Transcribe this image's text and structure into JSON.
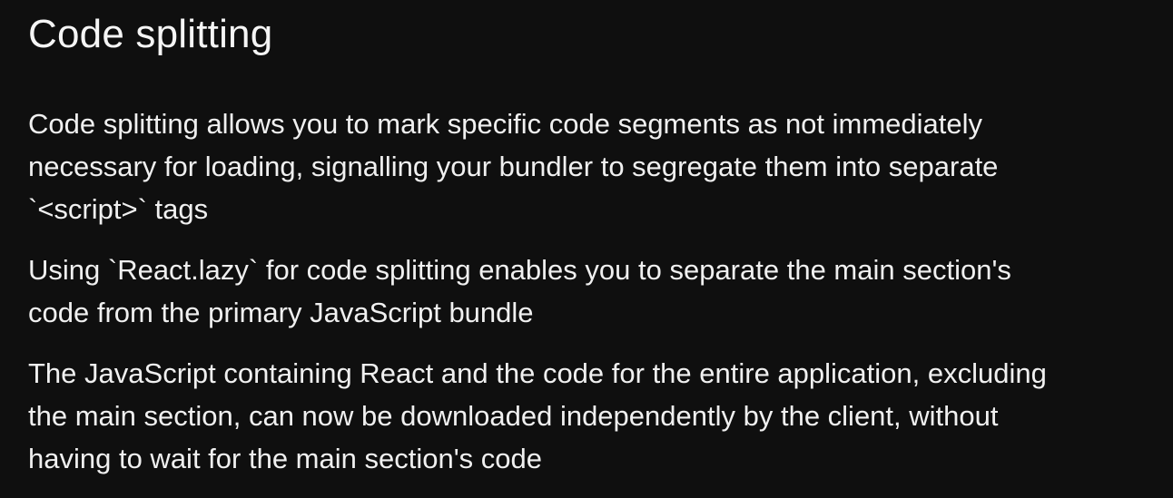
{
  "slide": {
    "title": "Code splitting",
    "paragraphs": [
      {
        "lines": [
          "Code splitting allows you to mark specific code segments as not immediately",
          "necessary for loading, signalling your bundler to segregate them into separate",
          "`<script>` tags"
        ]
      },
      {
        "lines": [
          "Using `React.lazy` for code splitting enables you to separate the main section's",
          "code from the primary JavaScript bundle"
        ]
      },
      {
        "lines": [
          "The JavaScript containing React and the code for the entire application, excluding",
          "the main section, can now be downloaded independently by the client, without",
          "having to wait for the main section's code"
        ]
      }
    ]
  }
}
